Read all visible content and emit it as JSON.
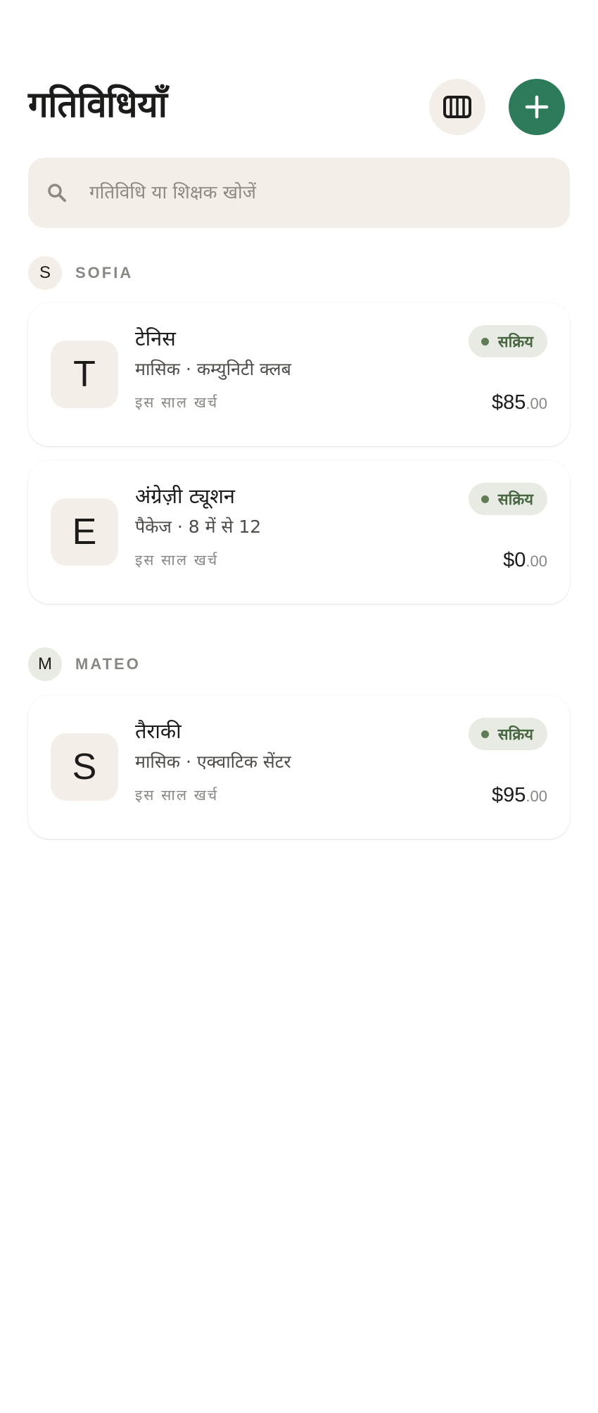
{
  "header": {
    "title": "गतिविधियाँ",
    "grid_icon": "grid-columns-icon",
    "add_icon": "plus-icon"
  },
  "search": {
    "placeholder": "गतिविधि या शिक्षक खोजें",
    "icon": "search-icon"
  },
  "colors": {
    "accent": "#2e7b5b",
    "surface": "#f3efe8",
    "status_bg": "#e7ebe3",
    "status_text": "#4a6642"
  },
  "groups": [
    {
      "initial": "S",
      "name": "SOFIA",
      "avatar_color": "#f3efe8",
      "activities": [
        {
          "initial": "T",
          "title": "टेनिस",
          "subtitle": "मासिक · कम्युनिटी क्लब",
          "status": "सक्रिय",
          "spent_label": "इस साल खर्च",
          "amount_main": "$85",
          "amount_cents": ".00"
        },
        {
          "initial": "E",
          "title": "अंग्रेज़ी ट्यूशन",
          "subtitle": "पैकेज · 8 में से 12",
          "status": "सक्रिय",
          "spent_label": "इस साल खर्च",
          "amount_main": "$0",
          "amount_cents": ".00"
        }
      ]
    },
    {
      "initial": "M",
      "name": "MATEO",
      "avatar_color": "#e7ebe3",
      "activities": [
        {
          "initial": "S",
          "title": "तैराकी",
          "subtitle": "मासिक · एक्वाटिक सेंटर",
          "status": "सक्रिय",
          "spent_label": "इस साल खर्च",
          "amount_main": "$95",
          "amount_cents": ".00"
        }
      ]
    }
  ]
}
